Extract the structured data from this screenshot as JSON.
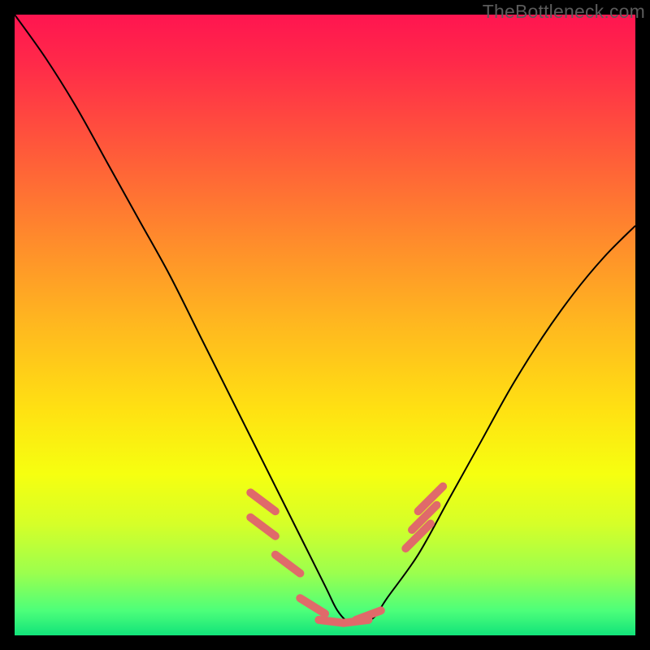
{
  "watermark": "TheBottleneck.com",
  "colors": {
    "frame": "#000000",
    "curve": "#000000",
    "dash": "#e06a6a",
    "gradient_top": "#ff1550",
    "gradient_bottom": "#12e37a"
  },
  "chart_data": {
    "type": "line",
    "title": "",
    "xlabel": "",
    "ylabel": "",
    "xlim": [
      0,
      100
    ],
    "ylim": [
      0,
      100
    ],
    "grid": false,
    "legend": false,
    "note": "No axes, ticks, or labels are rendered; values are estimated in 0–100 normalized space. Lower y = better (green).",
    "series": [
      {
        "name": "bottleneck-curve",
        "x": [
          0,
          5,
          10,
          15,
          20,
          25,
          30,
          35,
          40,
          45,
          50,
          52,
          54,
          56,
          58,
          60,
          65,
          70,
          75,
          80,
          85,
          90,
          95,
          100
        ],
        "y": [
          100,
          93,
          85,
          76,
          67,
          58,
          48,
          38,
          28,
          18,
          8,
          4,
          2,
          2,
          3,
          6,
          13,
          22,
          31,
          40,
          48,
          55,
          61,
          66
        ]
      }
    ],
    "highlight_dashes": {
      "note": "Short thick segments overlaid on the curve indicating specific data points/intervals.",
      "segments": [
        {
          "x": [
            38,
            42
          ],
          "y": [
            23,
            20
          ]
        },
        {
          "x": [
            38,
            42
          ],
          "y": [
            19,
            16
          ]
        },
        {
          "x": [
            42,
            46
          ],
          "y": [
            13,
            10
          ]
        },
        {
          "x": [
            46,
            50
          ],
          "y": [
            6,
            3.5
          ]
        },
        {
          "x": [
            49,
            53
          ],
          "y": [
            2.5,
            2
          ]
        },
        {
          "x": [
            53,
            57
          ],
          "y": [
            2,
            2.5
          ]
        },
        {
          "x": [
            55,
            59
          ],
          "y": [
            2.5,
            4
          ]
        },
        {
          "x": [
            63,
            67
          ],
          "y": [
            14,
            18
          ]
        },
        {
          "x": [
            64,
            68
          ],
          "y": [
            17,
            21
          ]
        },
        {
          "x": [
            65,
            69
          ],
          "y": [
            20,
            24
          ]
        }
      ]
    }
  }
}
